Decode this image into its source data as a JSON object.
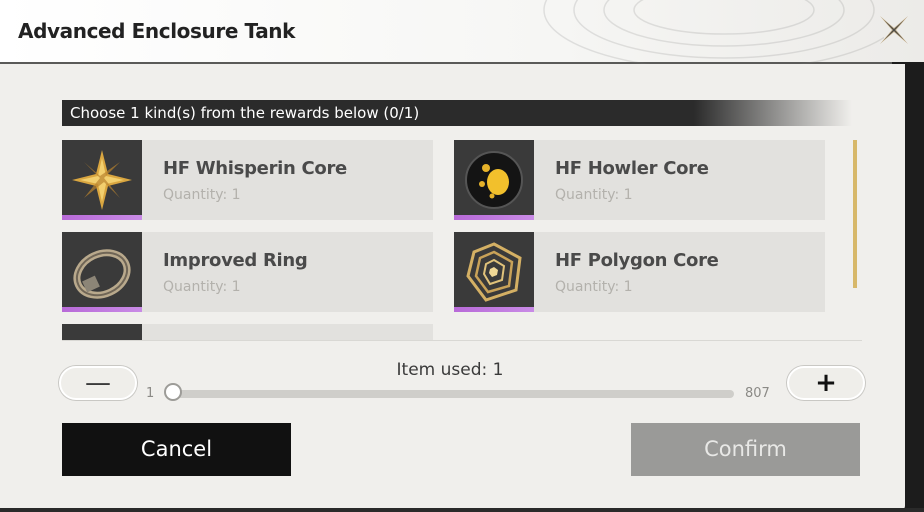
{
  "dialog": {
    "title": "Advanced Enclosure Tank"
  },
  "prompt": "Choose 1 kind(s) from the rewards below (0/1)",
  "rewards": [
    {
      "name": "HF Whisperin Core",
      "quantity": "Quantity: 1",
      "icon": "star-core-icon"
    },
    {
      "name": "HF Howler Core",
      "quantity": "Quantity: 1",
      "icon": "orb-core-icon"
    },
    {
      "name": "Improved Ring",
      "quantity": "Quantity: 1",
      "icon": "ring-icon"
    },
    {
      "name": "HF Polygon Core",
      "quantity": "Quantity: 1",
      "icon": "polygon-core-icon"
    }
  ],
  "usage": {
    "label": "Item used: 1",
    "min": "1",
    "max": "807",
    "value": 1
  },
  "buttons": {
    "cancel": "Cancel",
    "confirm": "Confirm"
  },
  "colors": {
    "rarity_bar": "#b86ad8",
    "scrollbar": "#d7b86a",
    "cancel_bg": "#111111",
    "confirm_bg": "#9a9a98"
  }
}
